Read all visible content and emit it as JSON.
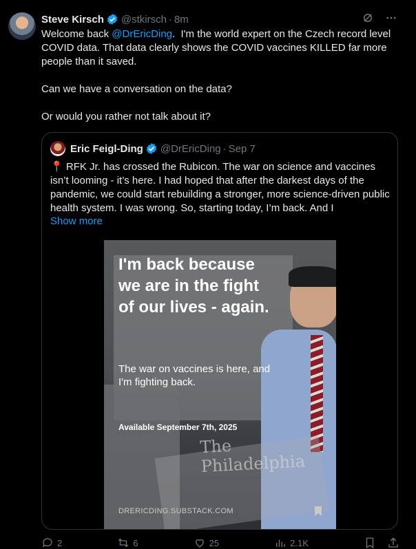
{
  "post": {
    "author_name": "Steve Kirsch",
    "handle": "@stkirsch",
    "dot": "·",
    "time": "8m",
    "text_intro": "Welcome back ",
    "mention": "@DrEricDing",
    "text_rest": ".  I'm the world expert on the Czech record level COVID data. That data clearly shows the COVID vaccines KILLED far more people than it saved.\n\nCan we have a conversation on the data?\n\nOr would you rather not talk about it?"
  },
  "quote": {
    "author_name": "Eric Feigl-Ding",
    "handle": "@DrEricDing",
    "dot": "·",
    "date": "Sep 7",
    "pin_icon": "📍",
    "text": "RFK Jr. has crossed the Rubicon. The war on science and vaccines isn’t looming - it’s here. I had hoped that after the darkest days of the pandemic, we could start rebuilding a stronger, more science-driven public health system. I was wrong. So, starting today, I’m back. And I",
    "show_more": "Show more",
    "media": {
      "title": "I'm back because we are in the fight of our lives - again.",
      "subtitle": "The war on vaccines is here, and I'm fighting back.",
      "date_line": "Available September 7th, 2025",
      "footer": "DRERICDING.SUBSTACK.COM",
      "newspaper": "The Philadelphia"
    }
  },
  "actions": {
    "reply_count": "2",
    "repost_count": "6",
    "like_count": "25",
    "views_count": "2.1K"
  },
  "colors": {
    "accent": "#1d9bf0",
    "muted": "#71767b",
    "border": "#2f3336",
    "background": "#000000"
  },
  "icons": [
    "verified-badge-icon",
    "grok-icon",
    "more-icon",
    "location-pin-icon",
    "bookmark-icon",
    "reply-icon",
    "repost-icon",
    "like-icon",
    "views-icon",
    "share-icon"
  ]
}
